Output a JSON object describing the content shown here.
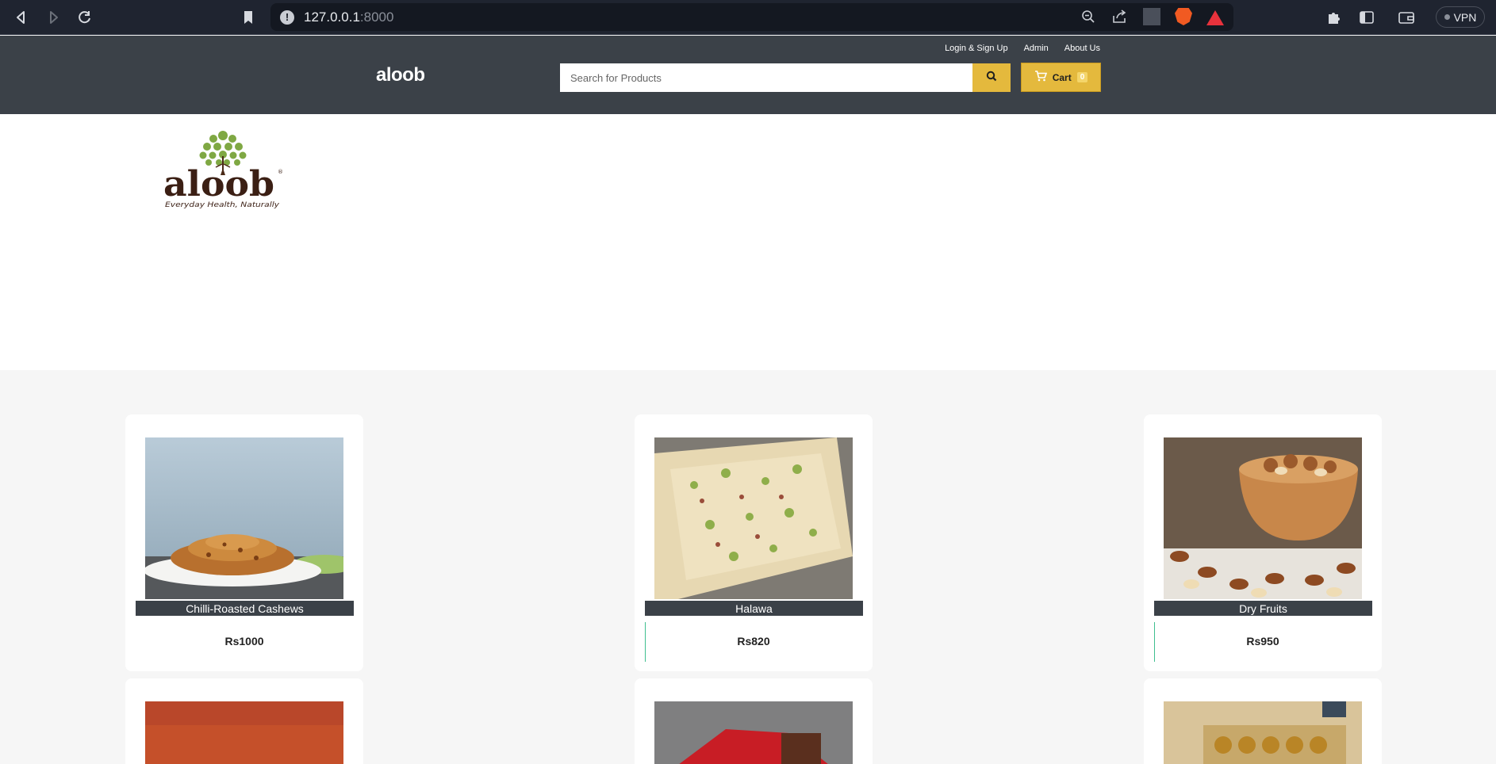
{
  "browser": {
    "url_host": "127.0.0.1",
    "url_port": ":8000",
    "vpn_label": "VPN"
  },
  "header": {
    "brand": "aloob",
    "links": [
      "Login & Sign Up",
      "Admin",
      "About Us"
    ],
    "search_placeholder": "Search for Products",
    "cart_label": "Cart",
    "cart_count": "0"
  },
  "banner": {
    "logo_text": "aloob",
    "logo_tagline": "Everyday Health, Naturally"
  },
  "products": [
    {
      "name": "Chilli-Roasted Cashews",
      "price": "Rs1000"
    },
    {
      "name": "Halawa",
      "price": "Rs820"
    },
    {
      "name": "Dry Fruits",
      "price": "Rs950"
    }
  ],
  "colors": {
    "header_bg": "#3b4148",
    "accent_yellow": "#e4b93d",
    "page_bg": "#f6f6f6"
  }
}
